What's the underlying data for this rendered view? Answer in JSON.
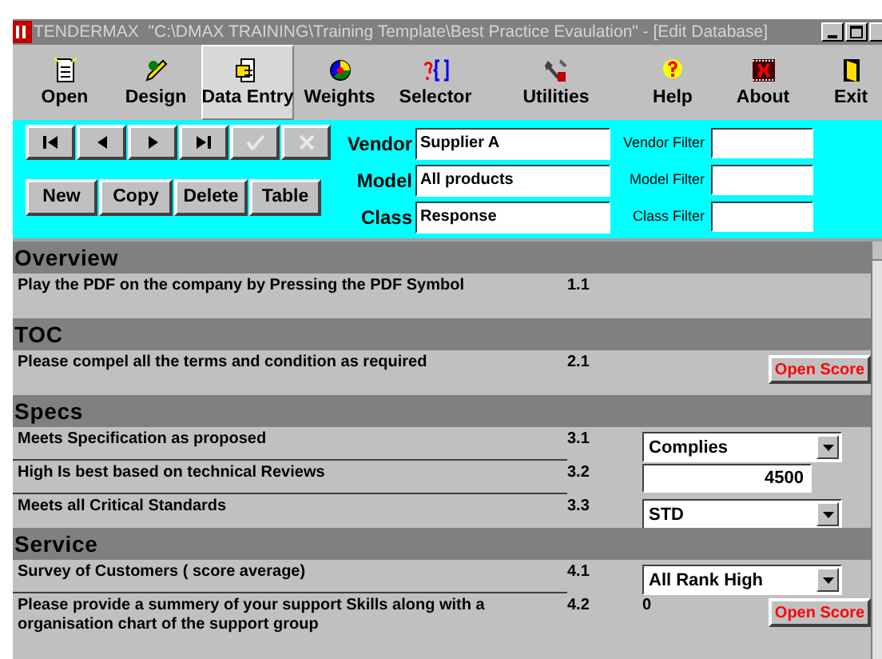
{
  "window": {
    "title": "TENDERMAX  \"C:\\DMAX TRAINING\\Training Template\\Best Practice Evaulation\" - [Edit Database]"
  },
  "toolbar": [
    {
      "label": "Open",
      "selected": false
    },
    {
      "label": "Design",
      "selected": false
    },
    {
      "label": "Data Entry",
      "selected": true
    },
    {
      "label": "Weights",
      "selected": false
    },
    {
      "label": "Selector",
      "selected": false
    },
    {
      "label": "Utilities",
      "selected": false
    },
    {
      "label": "Help",
      "selected": false
    },
    {
      "label": "About",
      "selected": false
    },
    {
      "label": "Exit",
      "selected": false
    }
  ],
  "navigator": [
    {
      "kind": "first",
      "disabled": false
    },
    {
      "kind": "prev",
      "disabled": false
    },
    {
      "kind": "next",
      "disabled": false
    },
    {
      "kind": "last",
      "disabled": false
    },
    {
      "kind": "save",
      "disabled": true
    },
    {
      "kind": "cancel",
      "disabled": true
    }
  ],
  "record_buttons": [
    "New",
    "Copy",
    "Delete",
    "Table"
  ],
  "fields": [
    {
      "label": "Vendor",
      "value": "Supplier A",
      "filter_label": "Vendor Filter"
    },
    {
      "label": "Model",
      "value": "All products",
      "filter_label": "Model Filter"
    },
    {
      "label": "Class",
      "value": "Response",
      "filter_label": "Class Filter"
    }
  ],
  "sections": [
    {
      "title": "Overview",
      "rows": [
        {
          "kind": "none",
          "question": "Play the PDF on the company by Pressing the PDF Symbol",
          "number": "1.1"
        }
      ]
    },
    {
      "title": "TOC",
      "rows": [
        {
          "kind": "button",
          "question": "Please compel all the terms and condition as required",
          "number": "2.1",
          "button": "Open Score"
        }
      ]
    },
    {
      "title": "Specs",
      "rows": [
        {
          "kind": "dropdown",
          "question": "Meets Specification as proposed",
          "number": "3.1",
          "value": "Complies"
        },
        {
          "kind": "number",
          "question": "High Is best based on technical Reviews",
          "number": "3.2",
          "value": "4500"
        },
        {
          "kind": "dropdown",
          "question": "Meets all Critical Standards",
          "number": "3.3",
          "value": "STD"
        }
      ]
    },
    {
      "title": "Service",
      "rows": [
        {
          "kind": "dropdown",
          "question": "Survey of Customers ( score average)",
          "number": "4.1",
          "value": "All Rank High"
        },
        {
          "kind": "value_button",
          "question": "Please provide a summery of your support Skills along with a organisation chart of the support group",
          "number": "4.2",
          "value": "0",
          "button": "Open Score"
        }
      ]
    }
  ]
}
